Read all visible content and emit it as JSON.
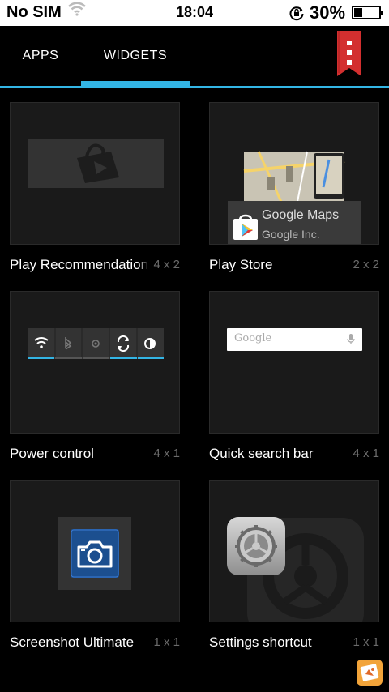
{
  "status_bar": {
    "carrier": "No SIM",
    "time": "18:04",
    "battery_percent": "30%",
    "battery_level": 0.3
  },
  "tabs": [
    {
      "label": "APPS",
      "active": false
    },
    {
      "label": "WIDGETS",
      "active": true
    }
  ],
  "widgets": [
    {
      "name": "Play Recommendations",
      "size": "4 x 2"
    },
    {
      "name": "Play Store",
      "size": "2 x 2",
      "preview_title": "Google Maps",
      "preview_subtitle": "Google Inc."
    },
    {
      "name": "Power control",
      "size": "4 x 1"
    },
    {
      "name": "Quick search bar",
      "size": "4 x 1",
      "preview_text": "Google"
    },
    {
      "name": "Screenshot Ultimate",
      "size": "1 x 1"
    },
    {
      "name": "Settings shortcut",
      "size": "1 x 1"
    }
  ],
  "colors": {
    "accent": "#33b5e5",
    "background": "#000000",
    "tile": "#1a1a1a",
    "size_text": "#6b6b6b",
    "menu_flag": "#d32f2f"
  }
}
